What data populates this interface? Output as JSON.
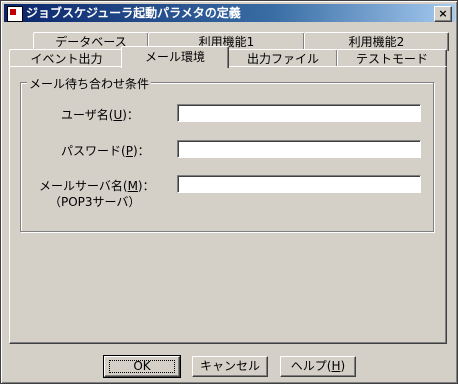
{
  "window": {
    "title": "ジョブスケジューラ起動パラメタの定義",
    "close_label": "×"
  },
  "tabs": {
    "row_back": [
      {
        "label": "データベース"
      },
      {
        "label": "利用機能1"
      },
      {
        "label": "利用機能2"
      }
    ],
    "row_front": [
      {
        "label": "イベント出力"
      },
      {
        "label": "メール環境"
      },
      {
        "label": "出力ファイル"
      },
      {
        "label": "テストモード"
      }
    ],
    "active": "メール環境"
  },
  "group": {
    "legend": "メール待ち合わせ条件",
    "fields": {
      "user": {
        "label": "ユーザ名(",
        "hotkey": "U",
        "label_end": ")：",
        "value": ""
      },
      "password": {
        "label": "パスワード(",
        "hotkey": "P",
        "label_end": ")：",
        "value": ""
      },
      "server": {
        "label": "メールサーバ名(",
        "hotkey": "M",
        "label_end": ")：",
        "sub": "（POP3サーバ）",
        "value": ""
      }
    }
  },
  "buttons": {
    "ok": "OK",
    "cancel": "キャンセル",
    "help_label": "ヘルプ(",
    "help_hotkey": "H",
    "help_end": ")"
  }
}
